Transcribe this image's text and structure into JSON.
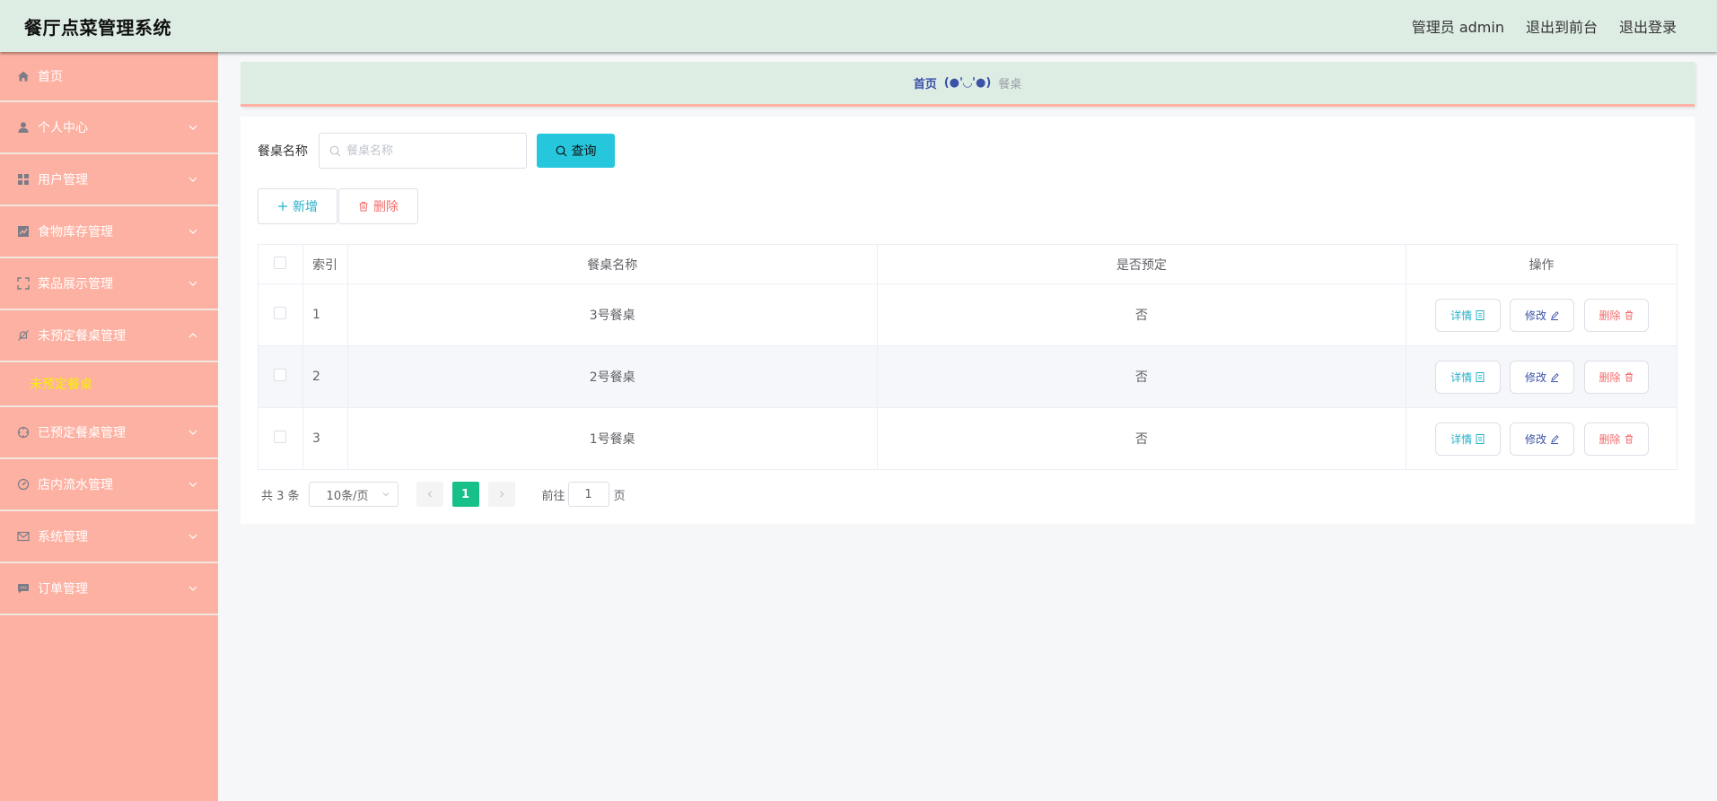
{
  "header": {
    "title": "餐厅点菜管理系统",
    "user": "管理员 admin",
    "to_front": "退出到前台",
    "logout": "退出登录"
  },
  "sidebar": {
    "items": [
      {
        "label": "首页",
        "icon": "home-icon"
      },
      {
        "label": "个人中心",
        "icon": "user-icon"
      },
      {
        "label": "用户管理",
        "icon": "grid-icon"
      },
      {
        "label": "食物库存管理",
        "icon": "chart-icon"
      },
      {
        "label": "菜品展示管理",
        "icon": "fullscreen-icon"
      },
      {
        "label": "未预定餐桌管理",
        "icon": "no-bell-icon",
        "expanded": true,
        "submenu": [
          "未预定餐桌"
        ]
      },
      {
        "label": "已预定餐桌管理",
        "icon": "compass-icon"
      },
      {
        "label": "店内流水管理",
        "icon": "speedometer-icon"
      },
      {
        "label": "系统管理",
        "icon": "mail-icon"
      },
      {
        "label": "订单管理",
        "icon": "chat-icon"
      }
    ],
    "bg_color": "#fdb1a2",
    "active_sub_color": "#f7f000"
  },
  "breadcrumb": {
    "home": "首页",
    "separator": "(●'◡'●)",
    "current": "餐桌"
  },
  "search": {
    "label": "餐桌名称",
    "placeholder": "餐桌名称",
    "button": "查询"
  },
  "actions": {
    "add": "新增",
    "delete": "删除"
  },
  "table": {
    "headers": [
      "索引",
      "餐桌名称",
      "是否预定",
      "操作"
    ],
    "rows": [
      {
        "index": "1",
        "name": "3号餐桌",
        "reserved": "否"
      },
      {
        "index": "2",
        "name": "2号餐桌",
        "reserved": "否"
      },
      {
        "index": "3",
        "name": "1号餐桌",
        "reserved": "否"
      }
    ],
    "ops": {
      "detail": "详情",
      "edit": "修改",
      "delete": "删除"
    }
  },
  "pagination": {
    "total": "共 3 条",
    "page_size": "10条/页",
    "current_page": "1",
    "goto_label": "前往",
    "goto_value": "1",
    "page_suffix": "页"
  },
  "colors": {
    "header_bg": "#deede4",
    "accent_cyan": "#26c7dc",
    "page_active": "#18c089",
    "danger": "#f56c6c"
  }
}
